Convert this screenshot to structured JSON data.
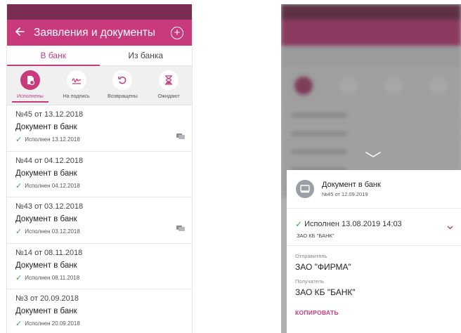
{
  "left": {
    "app_bar": {
      "title": "Заявления и документы",
      "back_icon": "arrow-left-icon",
      "add_icon": "plus-circle-icon"
    },
    "tabs": [
      {
        "label": "В банк",
        "active": true
      },
      {
        "label": "Из банка",
        "active": false
      }
    ],
    "filters": [
      {
        "label": "Исполнены",
        "icon": "document-check-icon",
        "active": true
      },
      {
        "label": "На подпись",
        "icon": "signature-icon",
        "active": false
      },
      {
        "label": "Возвращены",
        "icon": "undo-icon",
        "active": false
      },
      {
        "label": "Ожидают",
        "icon": "hourglass-icon",
        "active": false
      }
    ],
    "documents": [
      {
        "number": "№45 от 13.12.2018",
        "title": "Документ в банк",
        "status": "Исполнен 13.12.2018",
        "has_chat": true
      },
      {
        "number": "№44 от 04.12.2018",
        "title": "Документ в банк",
        "status": "Исполнен 04.12.2018",
        "has_chat": false
      },
      {
        "number": "№43 от 03.12.2018",
        "title": "Документ в банк",
        "status": "Исполнен 03.12.2018",
        "has_chat": true
      },
      {
        "number": "№14 от 08.11.2018",
        "title": "Документ в банк",
        "status": "Исполнен 08.11.2018",
        "has_chat": false
      },
      {
        "number": "№3 от 20.09.2018",
        "title": "Документ в банк",
        "status": "Исполнен 20.09.2018",
        "has_chat": false
      }
    ]
  },
  "right": {
    "sheet": {
      "title": "Документ в банк",
      "subtitle": "№45 от 12.09.2019",
      "status": "Исполнен 13.08.2019 14:03",
      "status_org": "ЗАО КБ \"БАНК\"",
      "sender_label": "Отправитель",
      "sender_value": "ЗАО \"ФИРМА\"",
      "receiver_label": "Получатель",
      "receiver_value": "ЗАО КБ \"БАНК\"",
      "copy_label": "КОПИРОВАТЬ"
    }
  },
  "colors": {
    "accent": "#c83a7c",
    "status_bar": "#7a2d52",
    "success": "#3fa34d"
  }
}
